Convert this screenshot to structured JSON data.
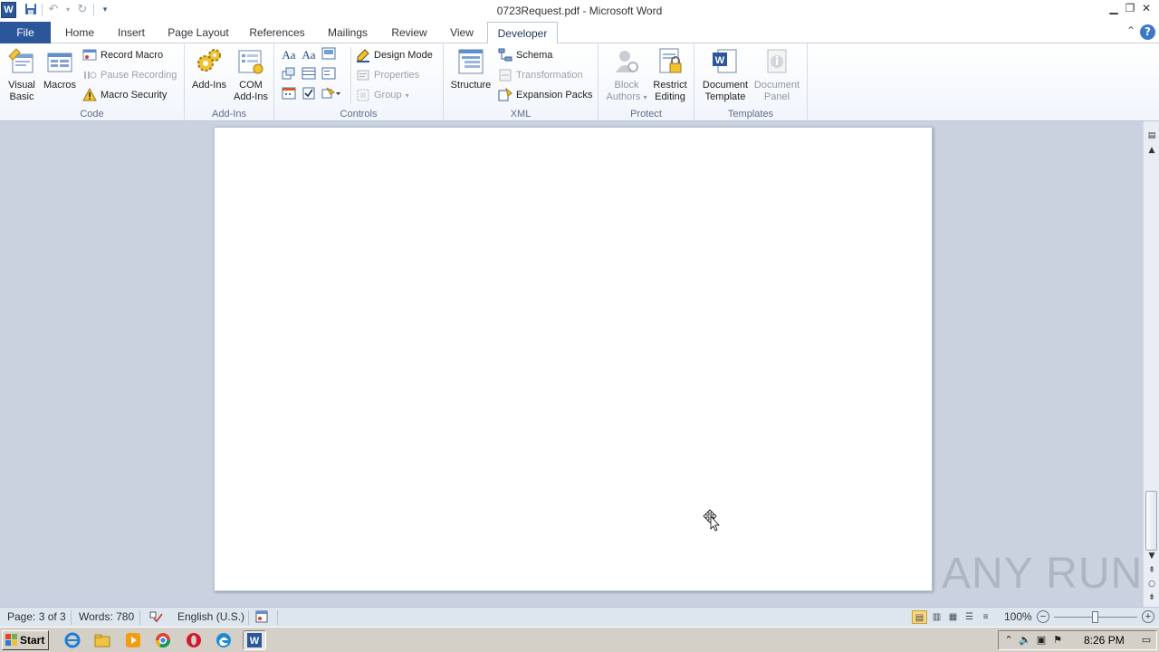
{
  "window": {
    "title": "0723Request.pdf - Microsoft Word",
    "app_icon_letter": "W"
  },
  "tabs": {
    "file": "File",
    "items": [
      "Home",
      "Insert",
      "Page Layout",
      "References",
      "Mailings",
      "Review",
      "View",
      "Developer"
    ],
    "active": "Developer"
  },
  "ribbon": {
    "code": {
      "label": "Code",
      "visual_basic": [
        "Visual",
        "Basic"
      ],
      "macros": "Macros",
      "record_macro": "Record Macro",
      "pause_recording": "Pause Recording",
      "macro_security": "Macro Security"
    },
    "addins": {
      "label": "Add-Ins",
      "addins": "Add-Ins",
      "com_addins": [
        "COM",
        "Add-Ins"
      ]
    },
    "controls": {
      "label": "Controls",
      "design_mode": "Design Mode",
      "properties": "Properties",
      "group": "Group"
    },
    "xml": {
      "label": "XML",
      "structure": "Structure",
      "schema": "Schema",
      "transformation": "Transformation",
      "expansion_packs": "Expansion Packs"
    },
    "protect": {
      "label": "Protect",
      "block_authors": [
        "Block",
        "Authors"
      ],
      "restrict_editing": [
        "Restrict",
        "Editing"
      ]
    },
    "templates": {
      "label": "Templates",
      "document_template": [
        "Document",
        "Template"
      ],
      "document_panel": [
        "Document",
        "Panel"
      ]
    }
  },
  "statusbar": {
    "page": "Page: 3 of 3",
    "words": "Words: 780",
    "language": "English (U.S.)",
    "zoom": "100%",
    "zoom_level_percent": 100
  },
  "watermark": "ANY RUN",
  "taskbar": {
    "start": "Start",
    "clock": "8:26 PM"
  },
  "colors": {
    "file_tab": "#2b579a",
    "doc_background": "#c9d2de",
    "ribbon_label": "#5c6e87"
  }
}
